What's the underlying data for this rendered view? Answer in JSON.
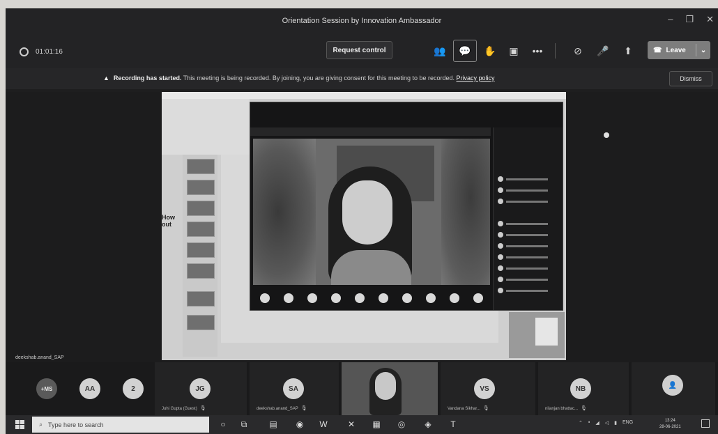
{
  "window": {
    "title": "Orientation Session by Innovation Ambassador",
    "controls": [
      "–",
      "❐",
      "✕"
    ]
  },
  "toolbar": {
    "timer": "01:01:16",
    "request_control": "Request control",
    "leave": "Leave",
    "icons": [
      "participants-icon",
      "chat-icon",
      "raise-hand-icon",
      "rooms-icon",
      "more-icon",
      "camera-off-icon",
      "mic-icon",
      "share-icon"
    ]
  },
  "banner": {
    "title": "Recording has started.",
    "message": " This meeting is being recorded. By joining, you are giving consent for this meeting to be recorded. ",
    "link": "Privacy policy",
    "dismiss": "Dismiss"
  },
  "stage": {
    "presenter_name": "deekshab.anand_SAP",
    "slide_text_1": "How",
    "slide_text_2": "out"
  },
  "participants": [
    {
      "initials": "+MS",
      "name": ""
    },
    {
      "initials": "AA",
      "name": ""
    },
    {
      "initials": "2",
      "name": ""
    },
    {
      "initials": "JG",
      "name": "Juhi Gupta (Guest)"
    },
    {
      "initials": "SA",
      "name": "deekshab.anand_SAP"
    },
    {
      "initials": "VS",
      "name": "Vandana Sikhar..."
    },
    {
      "initials": "NB",
      "name": "nilanjan bhattac..."
    }
  ],
  "taskbar": {
    "search_placeholder": "Type here to search",
    "time": "13:24",
    "date": "28-06-2021",
    "lang": "ENG"
  }
}
